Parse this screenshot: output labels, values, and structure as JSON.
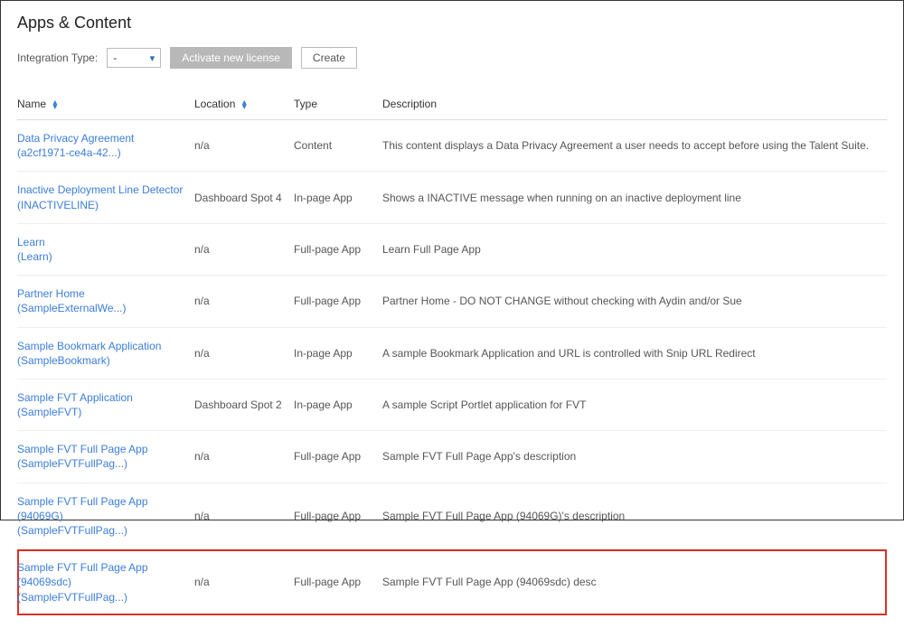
{
  "page_title": "Apps & Content",
  "toolbar": {
    "integration_label": "Integration Type:",
    "integration_value": "-",
    "activate_label": "Activate new license",
    "create_label": "Create"
  },
  "columns": {
    "name": "Name",
    "location": "Location",
    "type": "Type",
    "description": "Description"
  },
  "rows": [
    {
      "name": "Data Privacy Agreement",
      "sub": "(a2cf1971-ce4a-42...)",
      "location": "n/a",
      "type": "Content",
      "description": "This content displays a Data Privacy Agreement a user needs to accept before using the Talent Suite."
    },
    {
      "name": "Inactive Deployment Line Detector",
      "sub": "(INACTIVELINE)",
      "location": "Dashboard Spot 4",
      "type": "In-page App",
      "description": "Shows a INACTIVE message when running on an inactive deployment line"
    },
    {
      "name": "Learn",
      "sub": "(Learn)",
      "location": "n/a",
      "type": "Full-page App",
      "description": "Learn Full Page App"
    },
    {
      "name": "Partner Home",
      "sub": "(SampleExternalWe...)",
      "location": "n/a",
      "type": "Full-page App",
      "description": "Partner Home - DO NOT CHANGE without checking with Aydin and/or Sue"
    },
    {
      "name": "Sample Bookmark Application",
      "sub": "(SampleBookmark)",
      "location": "n/a",
      "type": "In-page App",
      "description": "A sample Bookmark Application and URL is controlled with Snip URL Redirect"
    },
    {
      "name": "Sample FVT Application",
      "sub": "(SampleFVT)",
      "location": "Dashboard Spot 2",
      "type": "In-page App",
      "description": "A sample Script Portlet application for FVT"
    },
    {
      "name": "Sample FVT Full Page App",
      "sub": "(SampleFVTFullPag...)",
      "location": "n/a",
      "type": "Full-page App",
      "description": "Sample FVT Full Page App's description"
    },
    {
      "name": "Sample FVT Full Page App (94069G)",
      "sub": "(SampleFVTFullPag...)",
      "location": "n/a",
      "type": "Full-page App",
      "description": "Sample FVT Full Page App (94069G)'s description"
    },
    {
      "name": "Sample FVT Full Page App (94069sdc)",
      "sub": "(SampleFVTFullPag...)",
      "location": "n/a",
      "type": "Full-page App",
      "description": "Sample FVT Full Page App (94069sdc) desc",
      "highlighted": true
    }
  ]
}
